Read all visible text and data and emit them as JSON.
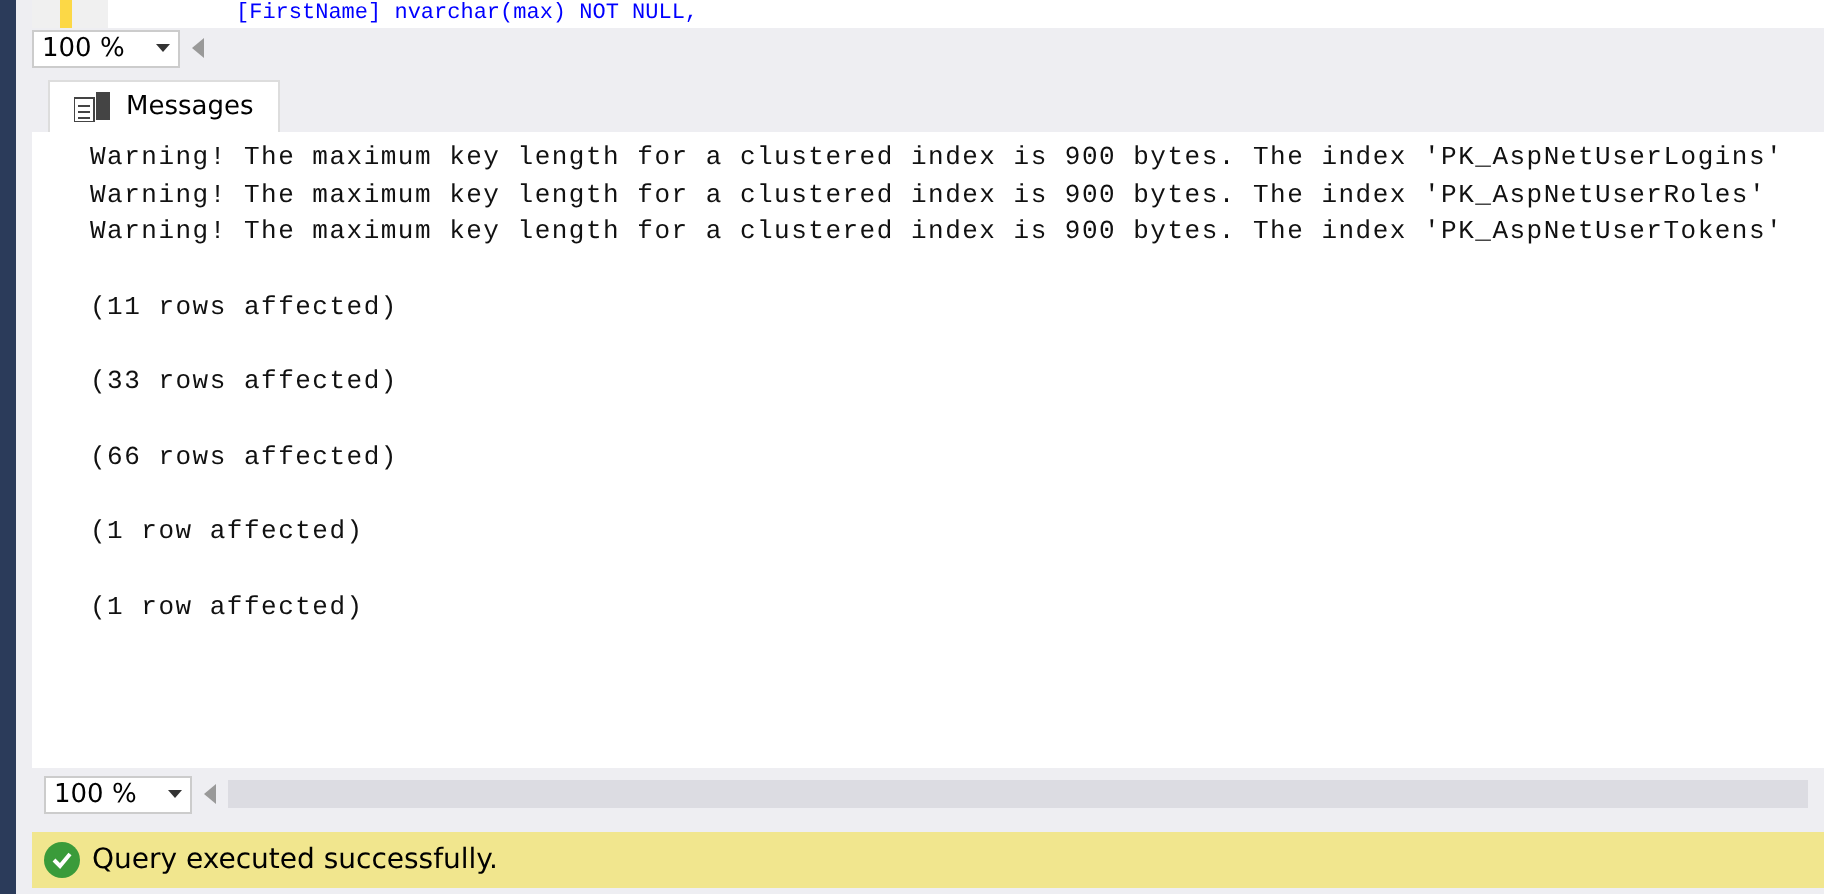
{
  "editor": {
    "code_line": "[FirstName] nvarchar(max) NOT NULL,"
  },
  "top_zoom": {
    "value": "100 %"
  },
  "tabs": [
    {
      "label": "Messages",
      "selected": true
    }
  ],
  "warnings": [
    "Warning! The maximum key length for a clustered index is 900 bytes. The index 'PK_AspNetUserLogins'",
    "Warning! The maximum key length for a clustered index is 900 bytes. The index 'PK_AspNetUserRoles'",
    "Warning! The maximum key length for a clustered index is 900 bytes. The index 'PK_AspNetUserTokens'"
  ],
  "results": [
    "(11 rows affected)",
    "(33 rows affected)",
    "(66 rows affected)",
    "(1 row affected)",
    "(1 row affected)"
  ],
  "bottom_zoom": {
    "value": "100 %"
  },
  "status_bar": {
    "text": "Query executed successfully."
  }
}
